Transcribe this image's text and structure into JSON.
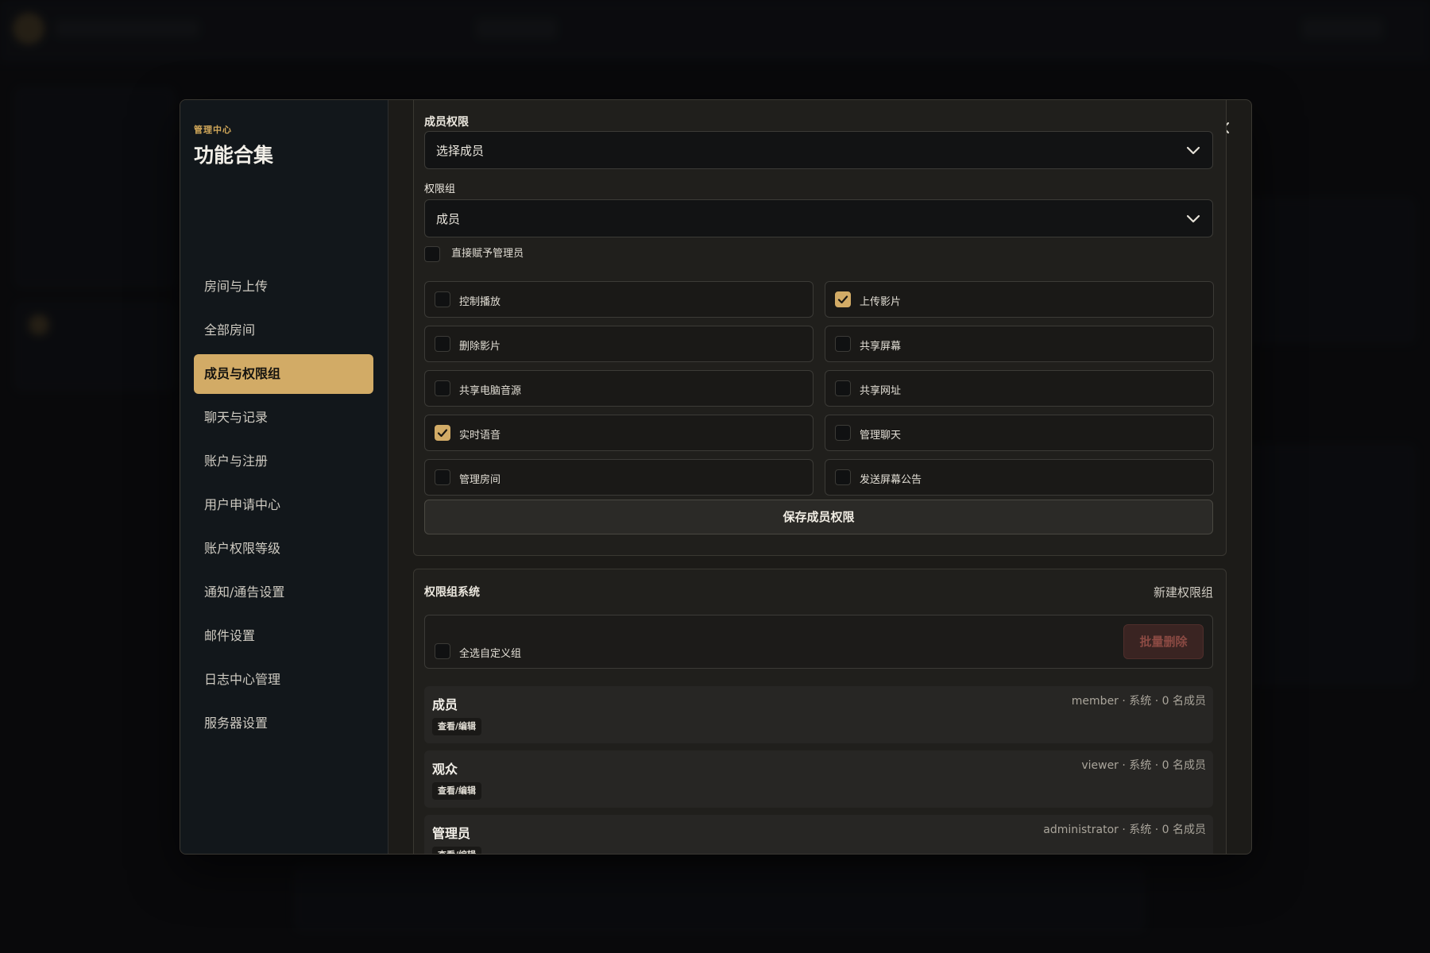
{
  "sidebar": {
    "eyebrow": "管理中心",
    "title": "功能合集",
    "items": [
      {
        "label": "房间与上传",
        "active": false
      },
      {
        "label": "全部房间",
        "active": false
      },
      {
        "label": "成员与权限组",
        "active": true
      },
      {
        "label": "聊天与记录",
        "active": false
      },
      {
        "label": "账户与注册",
        "active": false
      },
      {
        "label": "用户申请中心",
        "active": false
      },
      {
        "label": "账户权限等级",
        "active": false
      },
      {
        "label": "通知/通告设置",
        "active": false
      },
      {
        "label": "邮件设置",
        "active": false
      },
      {
        "label": "日志中心管理",
        "active": false
      },
      {
        "label": "服务器设置",
        "active": false
      }
    ]
  },
  "member_permissions": {
    "title": "成员权限",
    "member_select": {
      "value": "选择成员"
    },
    "group_label": "权限组",
    "group_select": {
      "value": "成员"
    },
    "grant_admin": {
      "label": "直接赋予管理员",
      "checked": false
    },
    "permissions": [
      {
        "label": "控制播放",
        "checked": false
      },
      {
        "label": "上传影片",
        "checked": true
      },
      {
        "label": "删除影片",
        "checked": false
      },
      {
        "label": "共享屏幕",
        "checked": false
      },
      {
        "label": "共享电脑音源",
        "checked": false
      },
      {
        "label": "共享网址",
        "checked": false
      },
      {
        "label": "实时语音",
        "checked": true
      },
      {
        "label": "管理聊天",
        "checked": false
      },
      {
        "label": "管理房间",
        "checked": false
      },
      {
        "label": "发送屏幕公告",
        "checked": false
      }
    ],
    "save_label": "保存成员权限"
  },
  "group_system": {
    "title": "权限组系统",
    "new_group_label": "新建权限组",
    "select_all_label": "全选自定义组",
    "bulk_delete_label": "批量删除",
    "groups": [
      {
        "name": "成员",
        "meta": "member · 系统 · 0 名成员",
        "edit_label": "查看/编辑"
      },
      {
        "name": "观众",
        "meta": "viewer · 系统 · 0 名成员",
        "edit_label": "查看/编辑"
      },
      {
        "name": "管理员",
        "meta": "administrator · 系统 · 0 名成员",
        "edit_label": "查看/编辑"
      }
    ]
  },
  "colors": {
    "accent": "#d2ab66",
    "modal_bg": "#1c1b18",
    "sidebar_bg": "#12171b",
    "danger_text": "#8b4a43"
  }
}
